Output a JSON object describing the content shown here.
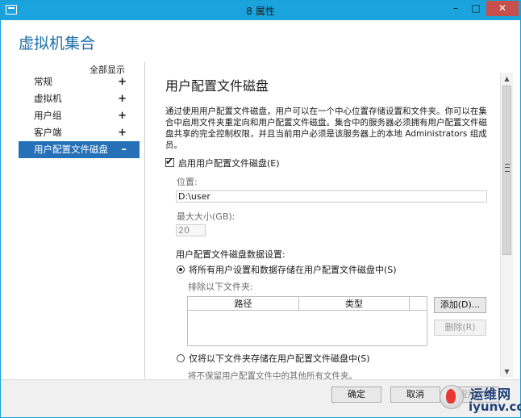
{
  "window": {
    "title": "8 属性",
    "minimize_label": "–",
    "maximize_label": "□",
    "close_label": "✕"
  },
  "app_heading": "虚拟机集合",
  "nav": {
    "show_all": "全部显示",
    "items": [
      {
        "label": "常规",
        "sign": "+"
      },
      {
        "label": "虚拟机",
        "sign": "+"
      },
      {
        "label": "用户组",
        "sign": "+"
      },
      {
        "label": "客户端",
        "sign": "+"
      },
      {
        "label": "用户配置文件磁盘",
        "sign": "–"
      }
    ]
  },
  "section": {
    "title": "用户配置文件磁盘",
    "description": "通过使用用户配置文件磁盘，用户可以在一个中心位置存储设置和文件夹。你可以在集合中启用文件夹重定向和用户配置文件磁盘。集合中的服务器必须拥有用户配置文件磁盘共享的完全控制权限，并且当前用户必须是该服务器上的本地 Administrators 组成员。",
    "enable_label": "启用用户配置文件磁盘(E)",
    "enable_checked": true,
    "location_label": "位置:",
    "location_value": "D:\\user",
    "max_size_label": "最大大小(GB):",
    "max_size_value": "20",
    "data_settings_label": "用户配置文件磁盘数据设置:",
    "option_all_label": "将所有用户设置和数据存储在用户配置文件磁盘中(S)",
    "exclude_label": "排除以下文件夹:",
    "table_headers": [
      "路径",
      "类型"
    ],
    "add_button": "添加(D)...",
    "delete_button": "删除(R)",
    "option_only_label": "仅将以下文件夹存储在用户配置文件磁盘中(S)",
    "note": "将不保留用户配置文件中的其他所有文件夹。"
  },
  "footer": {
    "ok": "确定",
    "cancel": "取消",
    "apply": "应用(A)"
  },
  "watermark": {
    "cn": "运维网",
    "en": "iyunv.com"
  },
  "colors": {
    "titlebar": "#1aa3dc",
    "accent": "#2670b8",
    "heading": "#1d6ea8",
    "close": "#c7504d"
  }
}
